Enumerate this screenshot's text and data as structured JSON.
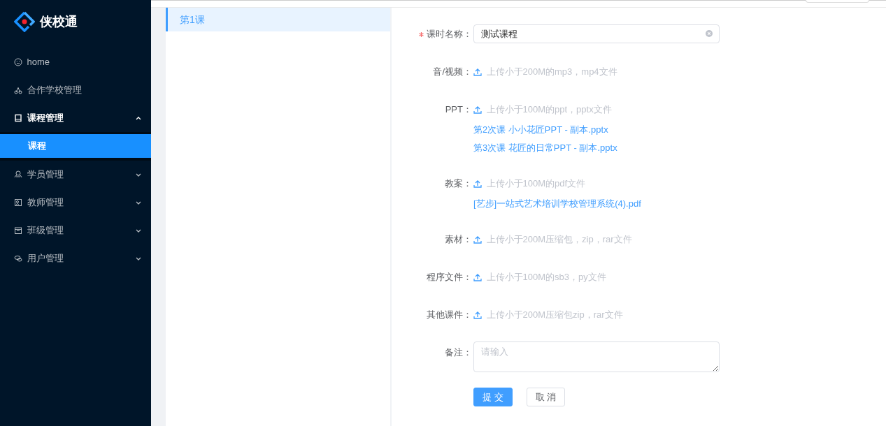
{
  "sidebar": {
    "logo_text": "侠校通",
    "items": [
      {
        "label": "home",
        "kind": "link",
        "selected": false
      },
      {
        "label": "合作学校管理",
        "kind": "link",
        "selected": false
      },
      {
        "label": "课程管理",
        "kind": "submenu",
        "selected": false,
        "expanded": true,
        "children": [
          {
            "label": "课程",
            "selected": true
          }
        ]
      },
      {
        "label": "学员管理",
        "kind": "submenu",
        "selected": false,
        "expanded": false
      },
      {
        "label": "教师管理",
        "kind": "submenu",
        "selected": false,
        "expanded": false
      },
      {
        "label": "班级管理",
        "kind": "submenu",
        "selected": false,
        "expanded": false
      },
      {
        "label": "用户管理",
        "kind": "submenu",
        "selected": false,
        "expanded": false
      }
    ]
  },
  "lessons": [
    {
      "label": "第1课",
      "selected": true
    }
  ],
  "form": {
    "fields": [
      {
        "kind": "text",
        "label": "课时名称：",
        "required": true,
        "value": "测试课程",
        "clearable": true
      },
      {
        "kind": "upload",
        "label": "音/视频：",
        "required": false,
        "hint": "上传小于200M的mp3，mp4文件"
      },
      {
        "kind": "upload",
        "label": "PPT：",
        "required": false,
        "hint": "上传小于100M的ppt，pptx文件",
        "files": [
          "第2次课 小小花匠PPT - 副本.pptx",
          "第3次课 花匠的日常PPT - 副本.pptx"
        ]
      },
      {
        "kind": "upload",
        "label": "教案：",
        "required": false,
        "hint": "上传小于100M的pdf文件",
        "files": [
          "[艺步]一站式艺术培训学校管理系统(4).pdf"
        ]
      },
      {
        "kind": "upload",
        "label": "素材：",
        "required": false,
        "hint": "上传小于200M压缩包，zip，rar文件"
      },
      {
        "kind": "upload",
        "label": "程序文件：",
        "required": false,
        "hint": "上传小于100M的sb3，py文件"
      },
      {
        "kind": "upload",
        "label": "其他课件：",
        "required": false,
        "hint": "上传小于200M压缩包zip，rar文件"
      },
      {
        "kind": "textarea",
        "label": "备注：",
        "required": false,
        "placeholder": "请输入"
      }
    ],
    "buttons": [
      {
        "label": "提 交",
        "kind": "primary"
      },
      {
        "label": "取 消",
        "kind": "default"
      }
    ]
  }
}
